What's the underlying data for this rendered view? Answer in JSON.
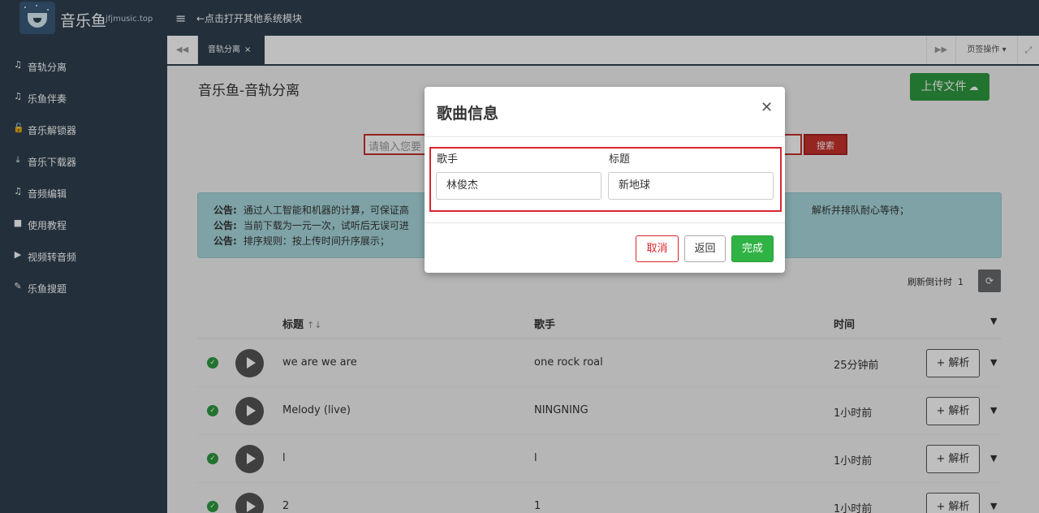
{
  "app": {
    "brand_name": "音乐鱼",
    "brand_domain": "jfjmusic.top",
    "top_link": "←点击打开其他系统模块"
  },
  "sidebar": {
    "items": [
      {
        "label": "音轨分离",
        "icon": "music-note-icon"
      },
      {
        "label": "乐鱼伴奏",
        "icon": "music-note-icon"
      },
      {
        "label": "音乐解锁器",
        "icon": "unlock-icon"
      },
      {
        "label": "音乐下载器",
        "icon": "download-icon"
      },
      {
        "label": "音频编辑",
        "icon": "music-note-icon"
      },
      {
        "label": "使用教程",
        "icon": "book-icon"
      },
      {
        "label": "视频转音频",
        "icon": "video-camera-icon"
      },
      {
        "label": "乐鱼搜题",
        "icon": "pencil-icon"
      }
    ]
  },
  "tabs": {
    "active_label": "音轨分离",
    "ops_label": "页签操作"
  },
  "page": {
    "title": "音乐鱼-音轨分离",
    "upload_label": "上传文件",
    "search_placeholder": "请输入您要",
    "search_label": "搜索",
    "notices": [
      {
        "key": "公告:",
        "text": "通过人工智能和机器的计算，可保证高"
      },
      {
        "key": "公告:",
        "text": "当前下载为一元一次，试听后无误可进"
      },
      {
        "key": "公告:",
        "text": "排序规则：按上传时间升序展示；"
      }
    ],
    "notice_tail": "解析并排队耐心等待；",
    "refresh_label": "刷新倒计时",
    "refresh_count": "1"
  },
  "table": {
    "headers": {
      "title": "标题",
      "artist": "歌手",
      "time": "时间"
    },
    "parse_label": "+ 解析",
    "rows": [
      {
        "title": "we are we are",
        "artist": "one rock roal",
        "time": "25分钟前"
      },
      {
        "title": "Melody (live)",
        "artist": "NINGNING",
        "time": "1小时前"
      },
      {
        "title": "l",
        "artist": "l",
        "time": "1小时前"
      },
      {
        "title": "2",
        "artist": "1",
        "time": "1小时前"
      }
    ]
  },
  "modal": {
    "title": "歌曲信息",
    "artist_label": "歌手",
    "artist_value": "林俊杰",
    "title_label": "标题",
    "title_value": "新地球",
    "cancel_label": "取消",
    "back_label": "返回",
    "done_label": "完成"
  },
  "colors": {
    "sidebar_bg": "#2f4050",
    "success": "#2fb344",
    "danger": "#d9262d",
    "notice_bg": "#a9d9dd"
  }
}
